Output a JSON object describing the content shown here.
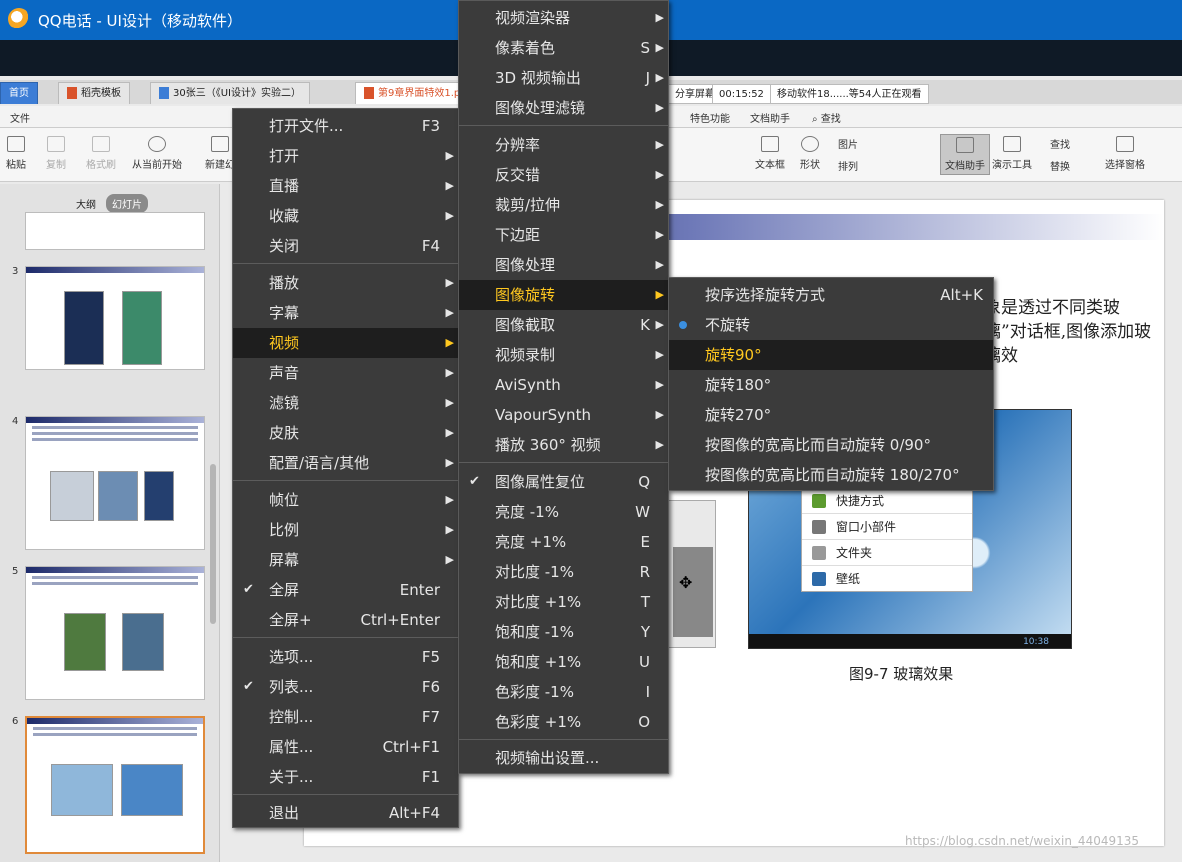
{
  "window": {
    "title": "QQ电话 - UI设计（移动软件）"
  },
  "app": {
    "tabs": [
      {
        "label": "首页"
      },
      {
        "label": "稻壳模板"
      },
      {
        "label": "30张三（《UI设计》实验二）"
      },
      {
        "label": "第9章界面特效1.p"
      }
    ],
    "share_info": [
      "分享屏幕",
      "00:15:52",
      "移动软件18......等54人正在观看"
    ],
    "menu_bar": [
      "文件",
      "特色功能",
      "文档助手",
      "查找"
    ],
    "ribbon": [
      "粘贴",
      "复制",
      "格式刷",
      "从当前开始",
      "新建幻",
      "文本框",
      "形状",
      "图片",
      "排列",
      "文档助手",
      "演示工具",
      "查找",
      "替换",
      "选择窗格"
    ],
    "panel_tabs": [
      "大纲",
      "幻灯片"
    ],
    "slide_numbers": [
      "3",
      "4",
      "5",
      "6"
    ],
    "slide": {
      "paragraph": "象是透过不同类玻璃”对话框,图像添加玻璃效",
      "popup_items": [
        "快捷方式",
        "窗口小部件",
        "文件夹",
        "壁纸"
      ],
      "status_time": "10:38",
      "caption": "图9-7  玻璃效果"
    },
    "watermark": "https://blog.csdn.net/weixin_44049135"
  },
  "menu_main": [
    {
      "label": "打开文件...",
      "shortcut": "F3"
    },
    {
      "label": "打开",
      "submenu": true
    },
    {
      "label": "直播",
      "submenu": true
    },
    {
      "label": "收藏",
      "submenu": true
    },
    {
      "label": "关闭",
      "shortcut": "F4"
    },
    {
      "label": "播放",
      "submenu": true
    },
    {
      "label": "字幕",
      "submenu": true
    },
    {
      "label": "视频",
      "submenu": true,
      "highlighted": true
    },
    {
      "label": "声音",
      "submenu": true
    },
    {
      "label": "滤镜",
      "submenu": true
    },
    {
      "label": "皮肤",
      "submenu": true
    },
    {
      "label": "配置/语言/其他",
      "submenu": true
    },
    {
      "label": "帧位",
      "submenu": true
    },
    {
      "label": "比例",
      "submenu": true
    },
    {
      "label": "屏幕",
      "submenu": true
    },
    {
      "label": "全屏",
      "shortcut": "Enter",
      "checked": true
    },
    {
      "label": "全屏+",
      "shortcut": "Ctrl+Enter"
    },
    {
      "label": "选项...",
      "shortcut": "F5"
    },
    {
      "label": "列表...",
      "shortcut": "F6",
      "checked": true
    },
    {
      "label": "控制...",
      "shortcut": "F7"
    },
    {
      "label": "属性...",
      "shortcut": "Ctrl+F1"
    },
    {
      "label": "关于...",
      "shortcut": "F1"
    },
    {
      "label": "退出",
      "shortcut": "Alt+F4"
    }
  ],
  "menu_video": [
    {
      "label": "视频渲染器",
      "submenu": true
    },
    {
      "label": "像素着色",
      "shortcut": "S",
      "submenu": true
    },
    {
      "label": "3D 视频输出",
      "shortcut": "J",
      "submenu": true
    },
    {
      "label": "图像处理滤镜",
      "submenu": true
    },
    {
      "label": "分辨率",
      "submenu": true
    },
    {
      "label": "反交错",
      "submenu": true
    },
    {
      "label": "裁剪/拉伸",
      "submenu": true
    },
    {
      "label": "下边距",
      "submenu": true
    },
    {
      "label": "图像处理",
      "submenu": true
    },
    {
      "label": "图像旋转",
      "submenu": true,
      "highlighted": true
    },
    {
      "label": "图像截取",
      "shortcut": "K",
      "submenu": true
    },
    {
      "label": "视频录制",
      "submenu": true
    },
    {
      "label": "AviSynth",
      "submenu": true
    },
    {
      "label": "VapourSynth",
      "submenu": true
    },
    {
      "label": "播放 360° 视频",
      "submenu": true
    },
    {
      "label": "图像属性复位",
      "shortcut": "Q",
      "checked": true
    },
    {
      "label": "亮度 -1%",
      "shortcut": "W"
    },
    {
      "label": "亮度 +1%",
      "shortcut": "E"
    },
    {
      "label": "对比度 -1%",
      "shortcut": "R"
    },
    {
      "label": "对比度 +1%",
      "shortcut": "T"
    },
    {
      "label": "饱和度 -1%",
      "shortcut": "Y"
    },
    {
      "label": "饱和度 +1%",
      "shortcut": "U"
    },
    {
      "label": "色彩度 -1%",
      "shortcut": "I"
    },
    {
      "label": "色彩度 +1%",
      "shortcut": "O"
    },
    {
      "label": "视频输出设置..."
    }
  ],
  "menu_rotate": [
    {
      "label": "按序选择旋转方式",
      "shortcut": "Alt+K"
    },
    {
      "label": "不旋转",
      "selected": true
    },
    {
      "label": "旋转90°",
      "highlighted": true
    },
    {
      "label": "旋转180°"
    },
    {
      "label": "旋转270°"
    },
    {
      "label": "按图像的宽高比而自动旋转 0/90°"
    },
    {
      "label": "按图像的宽高比而自动旋转 180/270°"
    }
  ],
  "colors": {
    "titlebar": "#0a68c4",
    "menu_bg": "#3b3b3b",
    "menu_highlight_bg": "#1e1e1e",
    "menu_highlight_text": "#ffc820",
    "radio_dot": "#3b8fe0"
  }
}
